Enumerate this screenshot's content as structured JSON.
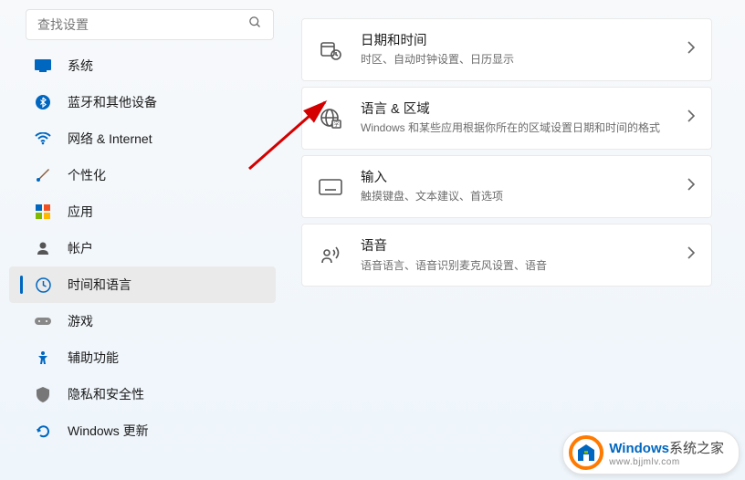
{
  "search": {
    "placeholder": "查找设置"
  },
  "sidebar": {
    "items": [
      {
        "label": "系统"
      },
      {
        "label": "蓝牙和其他设备"
      },
      {
        "label": "网络 & Internet"
      },
      {
        "label": "个性化"
      },
      {
        "label": "应用"
      },
      {
        "label": "帐户"
      },
      {
        "label": "时间和语言"
      },
      {
        "label": "游戏"
      },
      {
        "label": "辅助功能"
      },
      {
        "label": "隐私和安全性"
      },
      {
        "label": "Windows 更新"
      }
    ]
  },
  "cards": [
    {
      "title": "日期和时间",
      "sub": "时区、自动时钟设置、日历显示"
    },
    {
      "title": "语言 & 区域",
      "sub": "Windows 和某些应用根据你所在的区域设置日期和时间的格式"
    },
    {
      "title": "输入",
      "sub": "触摸键盘、文本建议、首选项"
    },
    {
      "title": "语音",
      "sub": "语音语言、语音识别麦克风设置、语音"
    }
  ],
  "watermark": {
    "brand": "Windows",
    "suffix": "系统之家",
    "url": "www.bjjmlv.com"
  }
}
